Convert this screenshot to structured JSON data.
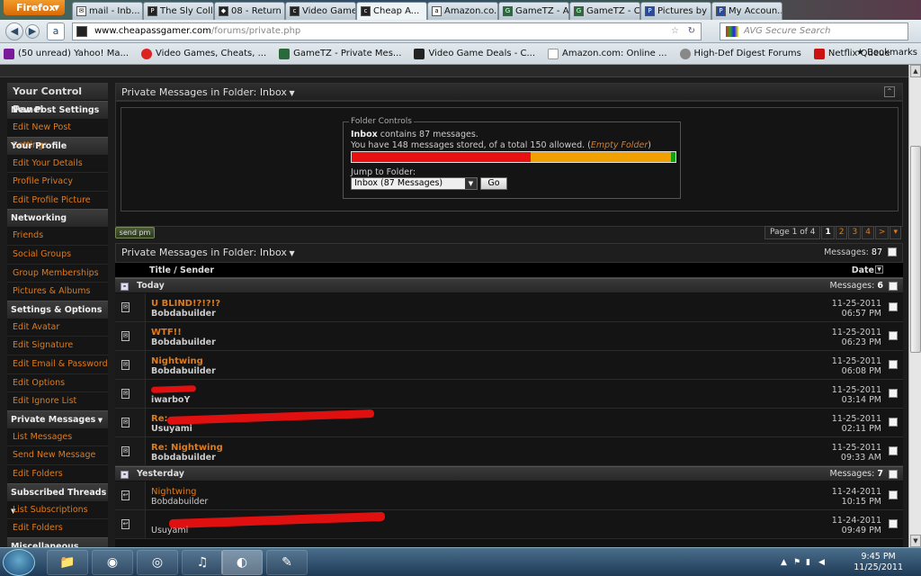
{
  "browser": {
    "menu_label": "Firefox",
    "tabs": [
      {
        "label": "mail - Inb..."
      },
      {
        "label": "The Sly Coll..."
      },
      {
        "label": "08 - Return ..."
      },
      {
        "label": "Video Game..."
      },
      {
        "label": "Cheap A..."
      },
      {
        "label": "Amazon.co..."
      },
      {
        "label": "GameTZ - A..."
      },
      {
        "label": "GameTZ - C..."
      },
      {
        "label": "Pictures by ..."
      },
      {
        "label": "My Accoun..."
      }
    ],
    "url_host": "www.cheapassgamer.com",
    "url_path": "/forums/private.php",
    "search_placeholder": "AVG Secure Search",
    "bookmarks": [
      {
        "label": "(50 unread) Yahoo! Ma..."
      },
      {
        "label": "Video Games, Cheats, ..."
      },
      {
        "label": "GameTZ - Private Mes..."
      },
      {
        "label": "Video Game Deals - C..."
      },
      {
        "label": "Amazon.com: Online ..."
      },
      {
        "label": "High-Def Digest Forums"
      },
      {
        "label": "Netflix Queue"
      }
    ],
    "bookmarks_menu": "Bookmarks"
  },
  "sidebar": {
    "title": "Your Control Panel",
    "sections": [
      {
        "name": "New Post Settings",
        "items": [
          "Edit New Post Settings"
        ]
      },
      {
        "name": "Your Profile",
        "items": [
          "Edit Your Details",
          "Profile Privacy",
          "Edit Profile Picture"
        ]
      },
      {
        "name": "Networking",
        "items": [
          "Friends",
          "Social Groups",
          "Group Memberships",
          "Pictures & Albums"
        ]
      },
      {
        "name": "Settings & Options",
        "items": [
          "Edit Avatar",
          "Edit Signature",
          "Edit Email & Password",
          "Edit Options",
          "Edit Ignore List"
        ]
      },
      {
        "name": "Private Messages",
        "items": [
          "List Messages",
          "Send New Message",
          "Edit Folders"
        ]
      },
      {
        "name": "Subscribed Threads",
        "items": [
          "List Subscriptions",
          "Edit Folders"
        ]
      },
      {
        "name": "Miscellaneous",
        "items": []
      }
    ]
  },
  "folder_panel": {
    "title_prefix": "Private Messages in Folder",
    "folder": "Inbox",
    "controls_legend": "Folder Controls",
    "inbox_label": "Inbox",
    "contains_text": "contains 87 messages.",
    "stored_text": "You have 148 messages stored, of a total 150 allowed.",
    "empty_folder": "Empty Folder",
    "jump_label": "Jump to Folder:",
    "jump_value": "Inbox (87 Messages)",
    "go_label": "Go",
    "usage": {
      "stored": 148,
      "total": 150
    },
    "usage_colors": {
      "red": "#e81010",
      "orange": "#f0a000",
      "green": "#10a010"
    }
  },
  "send_pm_label": "send pm",
  "pager": {
    "label": "Page 1 of 4",
    "pages": [
      "1",
      "2",
      "3",
      "4"
    ],
    "next": ">"
  },
  "list": {
    "title_prefix": "Private Messages in Folder",
    "folder": "Inbox",
    "messages_label": "Messages:",
    "messages_count": "87",
    "col_title": "Title / Sender",
    "col_date": "Date",
    "groups": [
      {
        "name": "Today",
        "count_label": "Messages:",
        "count": "6",
        "rows": [
          {
            "title": "U BLIND!?!?!?",
            "sender": "Bobdabuilder",
            "date": "11-25-2011",
            "time": "06:57 PM",
            "unread": true
          },
          {
            "title": "WTF!!",
            "sender": "Bobdabuilder",
            "date": "11-25-2011",
            "time": "06:23 PM",
            "unread": true
          },
          {
            "title": "Nightwing",
            "sender": "Bobdabuilder",
            "date": "11-25-2011",
            "time": "06:08 PM",
            "unread": true
          },
          {
            "title": "",
            "sender": "iwarboY",
            "date": "11-25-2011",
            "time": "03:14 PM",
            "unread": true
          },
          {
            "title": "Re:",
            "sender": "Usuyami",
            "date": "11-25-2011",
            "time": "02:11 PM",
            "unread": true
          },
          {
            "title": "Re: Nightwing",
            "sender": "Bobdabuilder",
            "date": "11-25-2011",
            "time": "09:33 AM",
            "unread": true
          }
        ]
      },
      {
        "name": "Yesterday",
        "count_label": "Messages:",
        "count": "7",
        "rows": [
          {
            "title": "Nightwing",
            "sender": "Bobdabuilder",
            "date": "11-24-2011",
            "time": "10:15 PM",
            "unread": false
          },
          {
            "title": "",
            "sender": "Usuyami",
            "date": "11-24-2011",
            "time": "09:49 PM",
            "unread": false
          }
        ]
      }
    ]
  },
  "taskbar": {
    "time": "9:45 PM",
    "date": "11/25/2011"
  }
}
